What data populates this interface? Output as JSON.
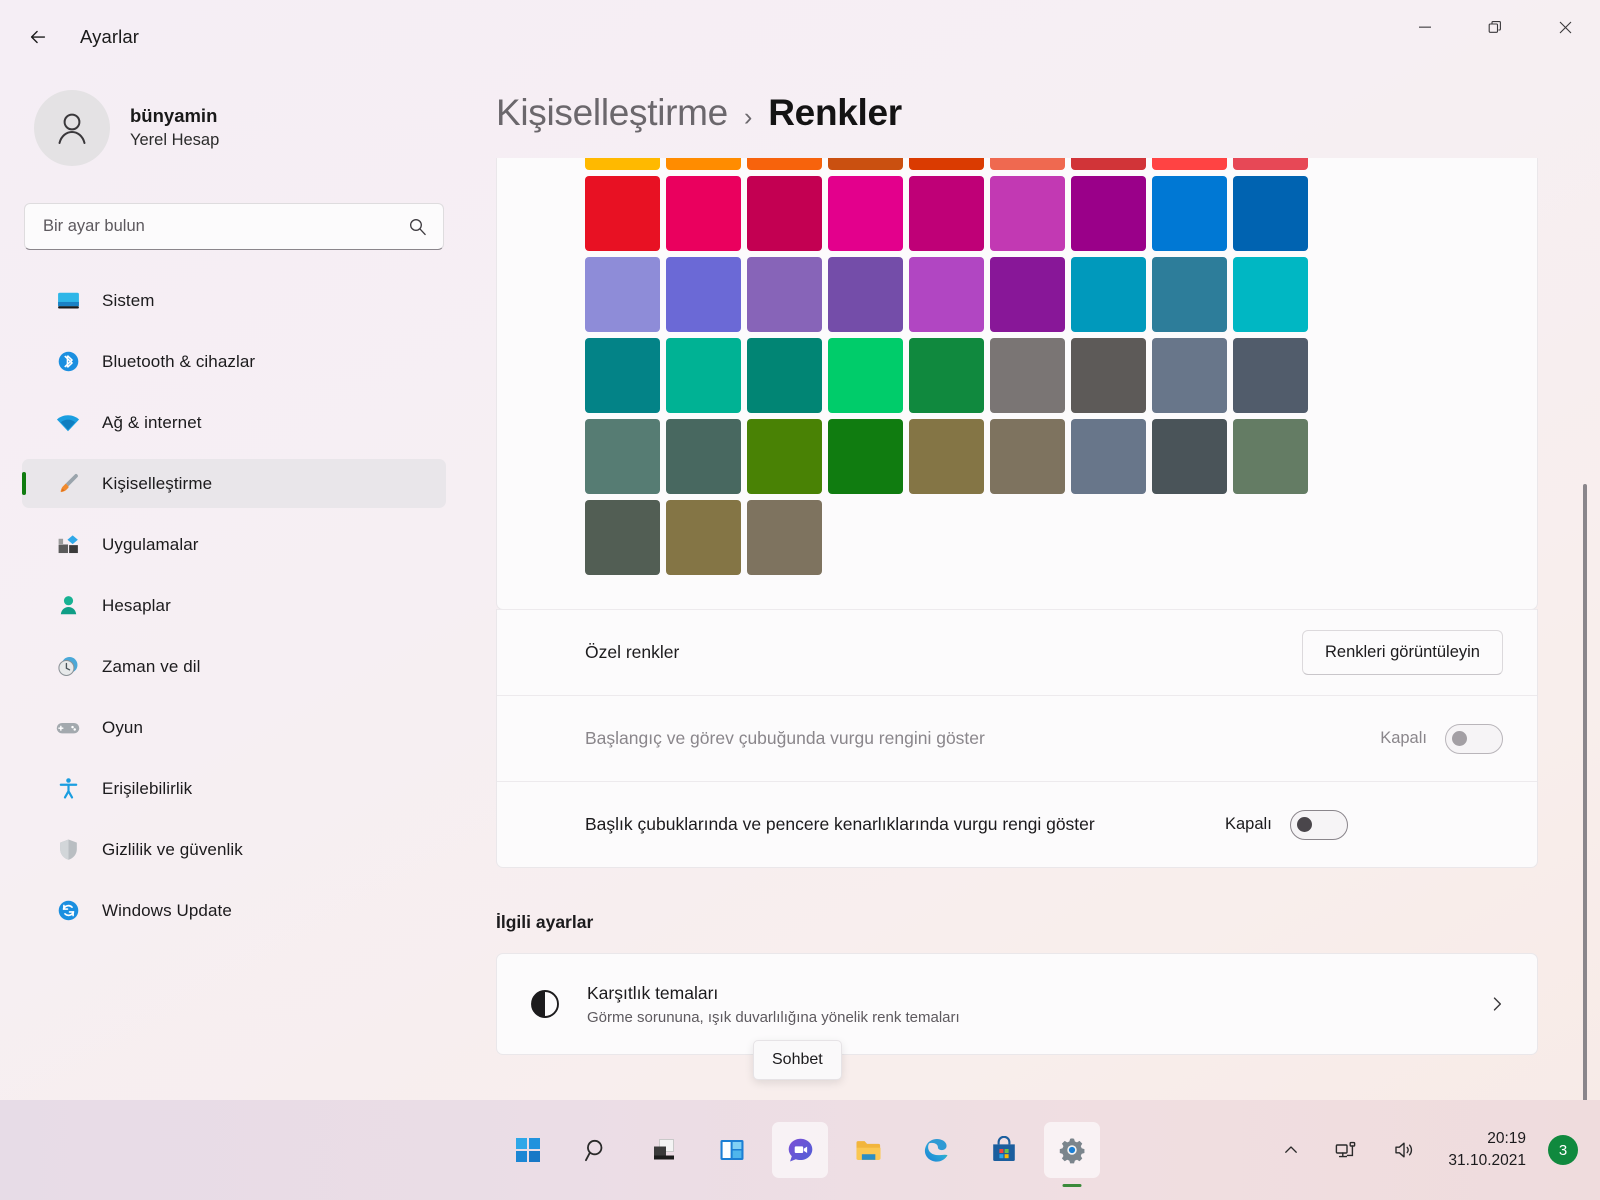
{
  "window": {
    "title": "Ayarlar",
    "back_icon": "arrow-left-icon",
    "minimize_label": "–",
    "restore_label": "❐",
    "close_label": "✕"
  },
  "sidebar": {
    "account": {
      "name": "bünyamin",
      "type": "Yerel Hesap",
      "avatar_icon": "person-icon"
    },
    "search": {
      "placeholder": "Bir ayar bulun",
      "value": "",
      "icon": "search-icon"
    },
    "items": [
      {
        "label": "Sistem",
        "icon": "monitor-icon",
        "active": false
      },
      {
        "label": "Bluetooth & cihazlar",
        "icon": "bluetooth-icon",
        "active": false
      },
      {
        "label": "Ağ & internet",
        "icon": "wifi-icon",
        "active": false
      },
      {
        "label": "Kişiselleştirme",
        "icon": "paintbrush-icon",
        "active": true
      },
      {
        "label": "Uygulamalar",
        "icon": "apps-icon",
        "active": false
      },
      {
        "label": "Hesaplar",
        "icon": "accounts-icon",
        "active": false
      },
      {
        "label": "Zaman ve dil",
        "icon": "clock-globe-icon",
        "active": false
      },
      {
        "label": "Oyun",
        "icon": "gamepad-icon",
        "active": false
      },
      {
        "label": "Erişilebilirlik",
        "icon": "accessibility-icon",
        "active": false
      },
      {
        "label": "Gizlilik ve güvenlik",
        "icon": "shield-icon",
        "active": false
      },
      {
        "label": "Windows Update",
        "icon": "update-icon",
        "active": false
      }
    ],
    "active_accent_color": "#107c10"
  },
  "main": {
    "breadcrumb": {
      "parent": "Kişiselleştirme",
      "separator": "›",
      "current": "Renkler"
    },
    "swatch_grid": {
      "clipped_top_row": [
        "#ffb900",
        "#ff8c00",
        "#f7630c",
        "#ca5010",
        "#da3b01",
        "#ef6950",
        "#d13438",
        "#ff4343",
        "#e74856"
      ],
      "rows": [
        [
          "#e81123",
          "#ea005e",
          "#c30052",
          "#e3008c",
          "#bf0077",
          "#c239b3",
          "#9a0089",
          "#0078d4",
          "#0063b1"
        ],
        [
          "#8e8cd8",
          "#6b69d6",
          "#8764b8",
          "#744da9",
          "#b146c2",
          "#881798",
          "#0099bc",
          "#2d7d9a",
          "#00b7c3"
        ],
        [
          "#038387",
          "#00b294",
          "#018574",
          "#00cc6a",
          "#10893e",
          "#7a7574",
          "#5d5a58",
          "#68768a",
          "#515c6b"
        ],
        [
          "#567c73",
          "#486860",
          "#498205",
          "#107c10",
          "#847545",
          "#7e735f",
          "#68768a",
          "#4a5459",
          "#647c64"
        ],
        [
          "#525e54",
          "#847545",
          "#7e735f"
        ]
      ]
    },
    "custom_colors": {
      "label": "Özel renkler",
      "button": "Renkleri görüntüleyin"
    },
    "toggles": [
      {
        "label": "Başlangıç ve görev çubuğunda vurgu rengini göster",
        "state": "Kapalı",
        "enabled": false
      },
      {
        "label": "Başlık çubuklarında ve pencere kenarlıklarında vurgu rengi göster",
        "state": "Kapalı",
        "enabled": true
      }
    ],
    "related": {
      "title": "İlgili ayarlar",
      "item": {
        "title": "Karşıtlık temaları",
        "subtitle": "Görme sorununa, ışık duvarlılığına yönelik renk temaları",
        "icon": "contrast-icon",
        "chevron": "chevron-right-icon"
      }
    }
  },
  "tooltip": {
    "text": "Sohbet"
  },
  "taskbar": {
    "items": [
      {
        "name": "start-button",
        "icon": "windows-logo-icon",
        "state": "normal"
      },
      {
        "name": "search-button",
        "icon": "search-icon",
        "state": "normal"
      },
      {
        "name": "task-view-button",
        "icon": "task-view-icon",
        "state": "normal"
      },
      {
        "name": "widgets-button",
        "icon": "widgets-icon",
        "state": "normal"
      },
      {
        "name": "chat-button",
        "icon": "chat-icon",
        "state": "hovered"
      },
      {
        "name": "file-explorer-button",
        "icon": "folder-icon",
        "state": "normal"
      },
      {
        "name": "edge-button",
        "icon": "edge-icon",
        "state": "normal"
      },
      {
        "name": "store-button",
        "icon": "store-icon",
        "state": "normal"
      },
      {
        "name": "settings-button",
        "icon": "gear-icon",
        "state": "active"
      }
    ],
    "tray": {
      "chevron": "chevron-up-icon",
      "network": "network-icon",
      "volume": "volume-icon",
      "time": "20:19",
      "date": "31.10.2021",
      "badge_count": "3",
      "badge_color": "#10893e"
    }
  }
}
